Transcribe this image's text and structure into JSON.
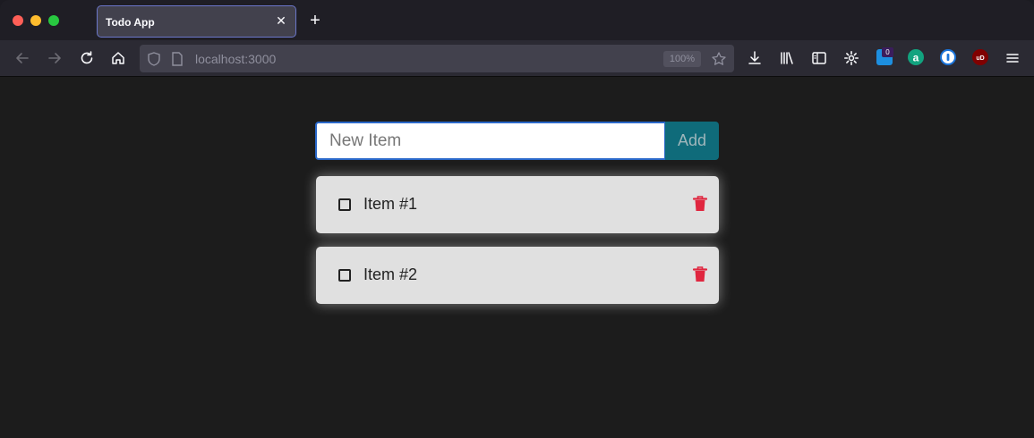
{
  "browser": {
    "tab_title": "Todo App",
    "tab_close": "✕",
    "new_tab": "+",
    "url": "localhost:3000",
    "zoom": "100%",
    "extension_badge": "0"
  },
  "app": {
    "new_item_placeholder": "New Item",
    "add_label": "Add",
    "items": [
      {
        "name": "Item #1",
        "completed": false
      },
      {
        "name": "Item #2",
        "completed": false
      }
    ]
  },
  "colors": {
    "add_button": "#0f6b7a",
    "input_border": "#2a68c9",
    "item_background": "#e0e0e0",
    "delete_icon": "#e0263f",
    "page_background": "#1c1c1c"
  }
}
